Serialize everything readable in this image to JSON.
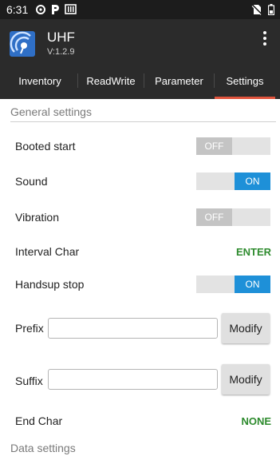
{
  "status_bar": {
    "time": "6:31",
    "icons": [
      "data-saver-icon",
      "parking-icon",
      "storage-icon",
      "no-sim-icon",
      "battery-icon"
    ]
  },
  "app": {
    "title": "UHF",
    "version": "V:1.2.9",
    "logo_icon": "uhf-antenna-logo",
    "menu_icon": "overflow-menu-icon"
  },
  "tabs": [
    {
      "label": "Inventory",
      "active": false
    },
    {
      "label": "ReadWrite",
      "active": false
    },
    {
      "label": "Parameter",
      "active": false
    },
    {
      "label": "Settings",
      "active": true
    }
  ],
  "general": {
    "section_title": "General settings",
    "booted_start": {
      "label": "Booted start",
      "state": "OFF"
    },
    "sound": {
      "label": "Sound",
      "state": "ON"
    },
    "vibration": {
      "label": "Vibration",
      "state": "OFF"
    },
    "interval_char": {
      "label": "Interval Char",
      "value": "ENTER"
    },
    "handsup_stop": {
      "label": "Handsup stop",
      "state": "ON"
    },
    "prefix": {
      "label": "Prefix",
      "value": "",
      "button": "Modify"
    },
    "suffix": {
      "label": "Suffix",
      "value": "",
      "button": "Modify"
    },
    "end_char": {
      "label": "End Char",
      "value": "NONE"
    }
  },
  "data": {
    "section_title": "Data settings"
  },
  "colors": {
    "toolbar": "#2b2b2b",
    "tab_indicator": "#e0533c",
    "toggle_on": "#1e90d8",
    "toggle_off": "#c4c4c4",
    "value_green": "#2e8b2e"
  }
}
